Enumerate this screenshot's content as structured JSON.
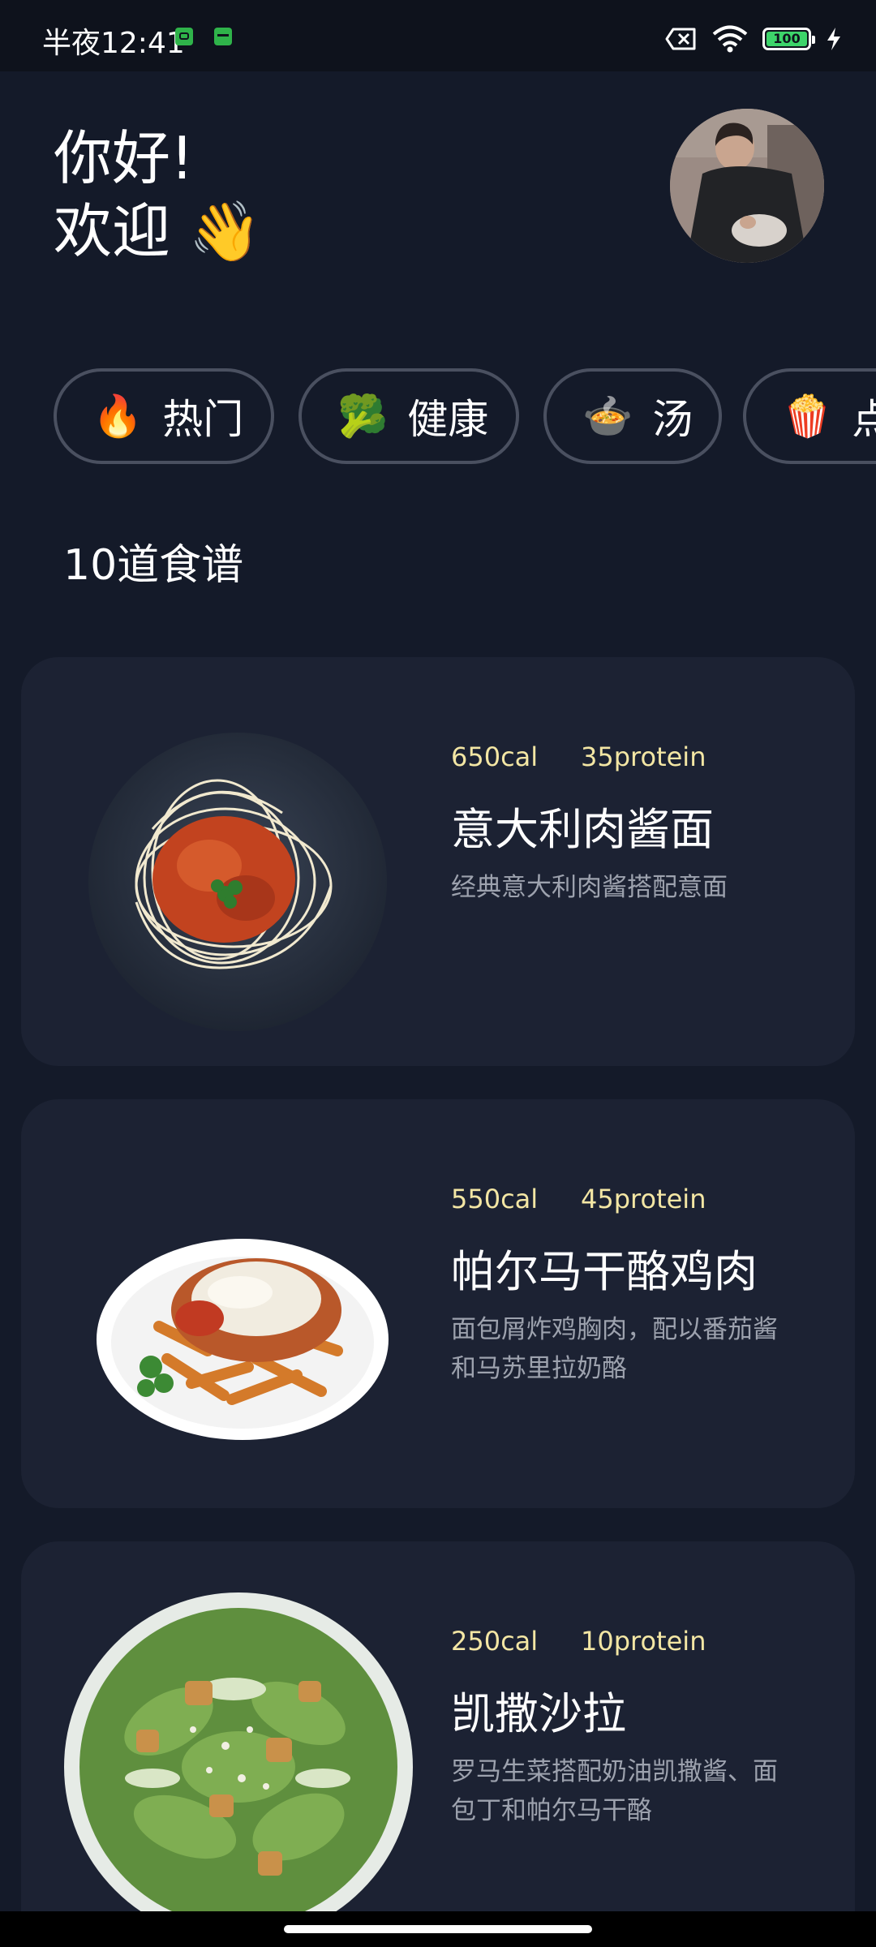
{
  "status_bar": {
    "time": "半夜12:41",
    "battery": "100",
    "icons": [
      "app-notification-icon",
      "shop-notification-icon",
      "sim-error-icon",
      "wifi-icon",
      "battery-icon",
      "charging-icon"
    ]
  },
  "header": {
    "greeting_line1": "你好!",
    "greeting_line2": "欢迎 👋",
    "avatar": "user-avatar-photo"
  },
  "categories": [
    {
      "emoji": "🔥",
      "label": "热门"
    },
    {
      "emoji": "🥦",
      "label": "健康"
    },
    {
      "emoji": "🍲",
      "label": "汤"
    },
    {
      "emoji": "🍿",
      "label": "点"
    }
  ],
  "recipe_count_title": "10道食谱",
  "recipes": [
    {
      "cal": "650cal",
      "protein": "35protein",
      "title": "意大利肉酱面",
      "desc": "经典意大利肉酱搭配意面",
      "image": "spaghetti-bolognese"
    },
    {
      "cal": "550cal",
      "protein": "45protein",
      "title": "帕尔马干酪鸡肉",
      "desc": "面包屑炸鸡胸肉，配以番茄酱和马苏里拉奶酪",
      "image": "chicken-parmesan"
    },
    {
      "cal": "250cal",
      "protein": "10protein",
      "title": "凯撒沙拉",
      "desc": "罗马生菜搭配奶油凯撒酱、面包丁和帕尔马干酪",
      "image": "caesar-salad"
    }
  ],
  "colors": {
    "background": "#141a29",
    "card": "#1c2233",
    "accent_meta": "#f3e6a4",
    "chip_border": "#4a5060"
  }
}
